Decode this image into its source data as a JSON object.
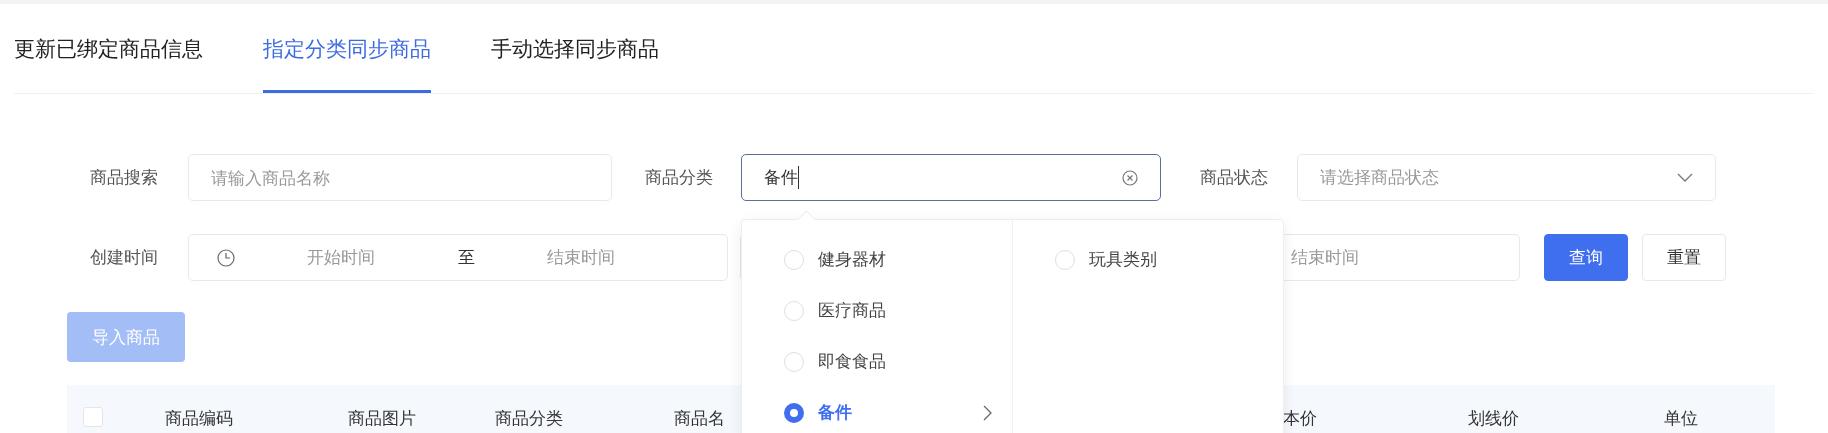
{
  "tabs": [
    {
      "label": "更新已绑定商品信息",
      "selected": false
    },
    {
      "label": "指定分类同步商品",
      "selected": true
    },
    {
      "label": "手动选择同步商品",
      "selected": false
    }
  ],
  "filters": {
    "search": {
      "label": "商品搜索",
      "placeholder": "请输入商品名称"
    },
    "category": {
      "label": "商品分类",
      "value": "备件"
    },
    "status": {
      "label": "商品状态",
      "placeholder": "请选择商品状态"
    },
    "created": {
      "label": "创建时间",
      "start_placeholder": "开始时间",
      "separator": "至",
      "end_placeholder": "结束时间"
    },
    "range_2": {
      "end_placeholder": "结束时间"
    }
  },
  "buttons": {
    "query": "查询",
    "reset": "重置"
  },
  "import_button": {
    "label": "导入商品",
    "disabled": true
  },
  "table": {
    "select_all_checked": false,
    "columns": [
      "商品编码",
      "商品图片",
      "商品分类",
      "商品名",
      "本价",
      "划线价",
      "单位"
    ]
  },
  "cascader": {
    "columns": [
      {
        "options": [
          {
            "label": "健身器材",
            "selected": false,
            "has_children": false
          },
          {
            "label": "医疗商品",
            "selected": false,
            "has_children": false
          },
          {
            "label": "即食食品",
            "selected": false,
            "has_children": false
          },
          {
            "label": "备件",
            "selected": true,
            "has_children": true
          }
        ]
      },
      {
        "options": [
          {
            "label": "玩具类别",
            "selected": false,
            "has_children": false
          }
        ]
      }
    ]
  }
}
